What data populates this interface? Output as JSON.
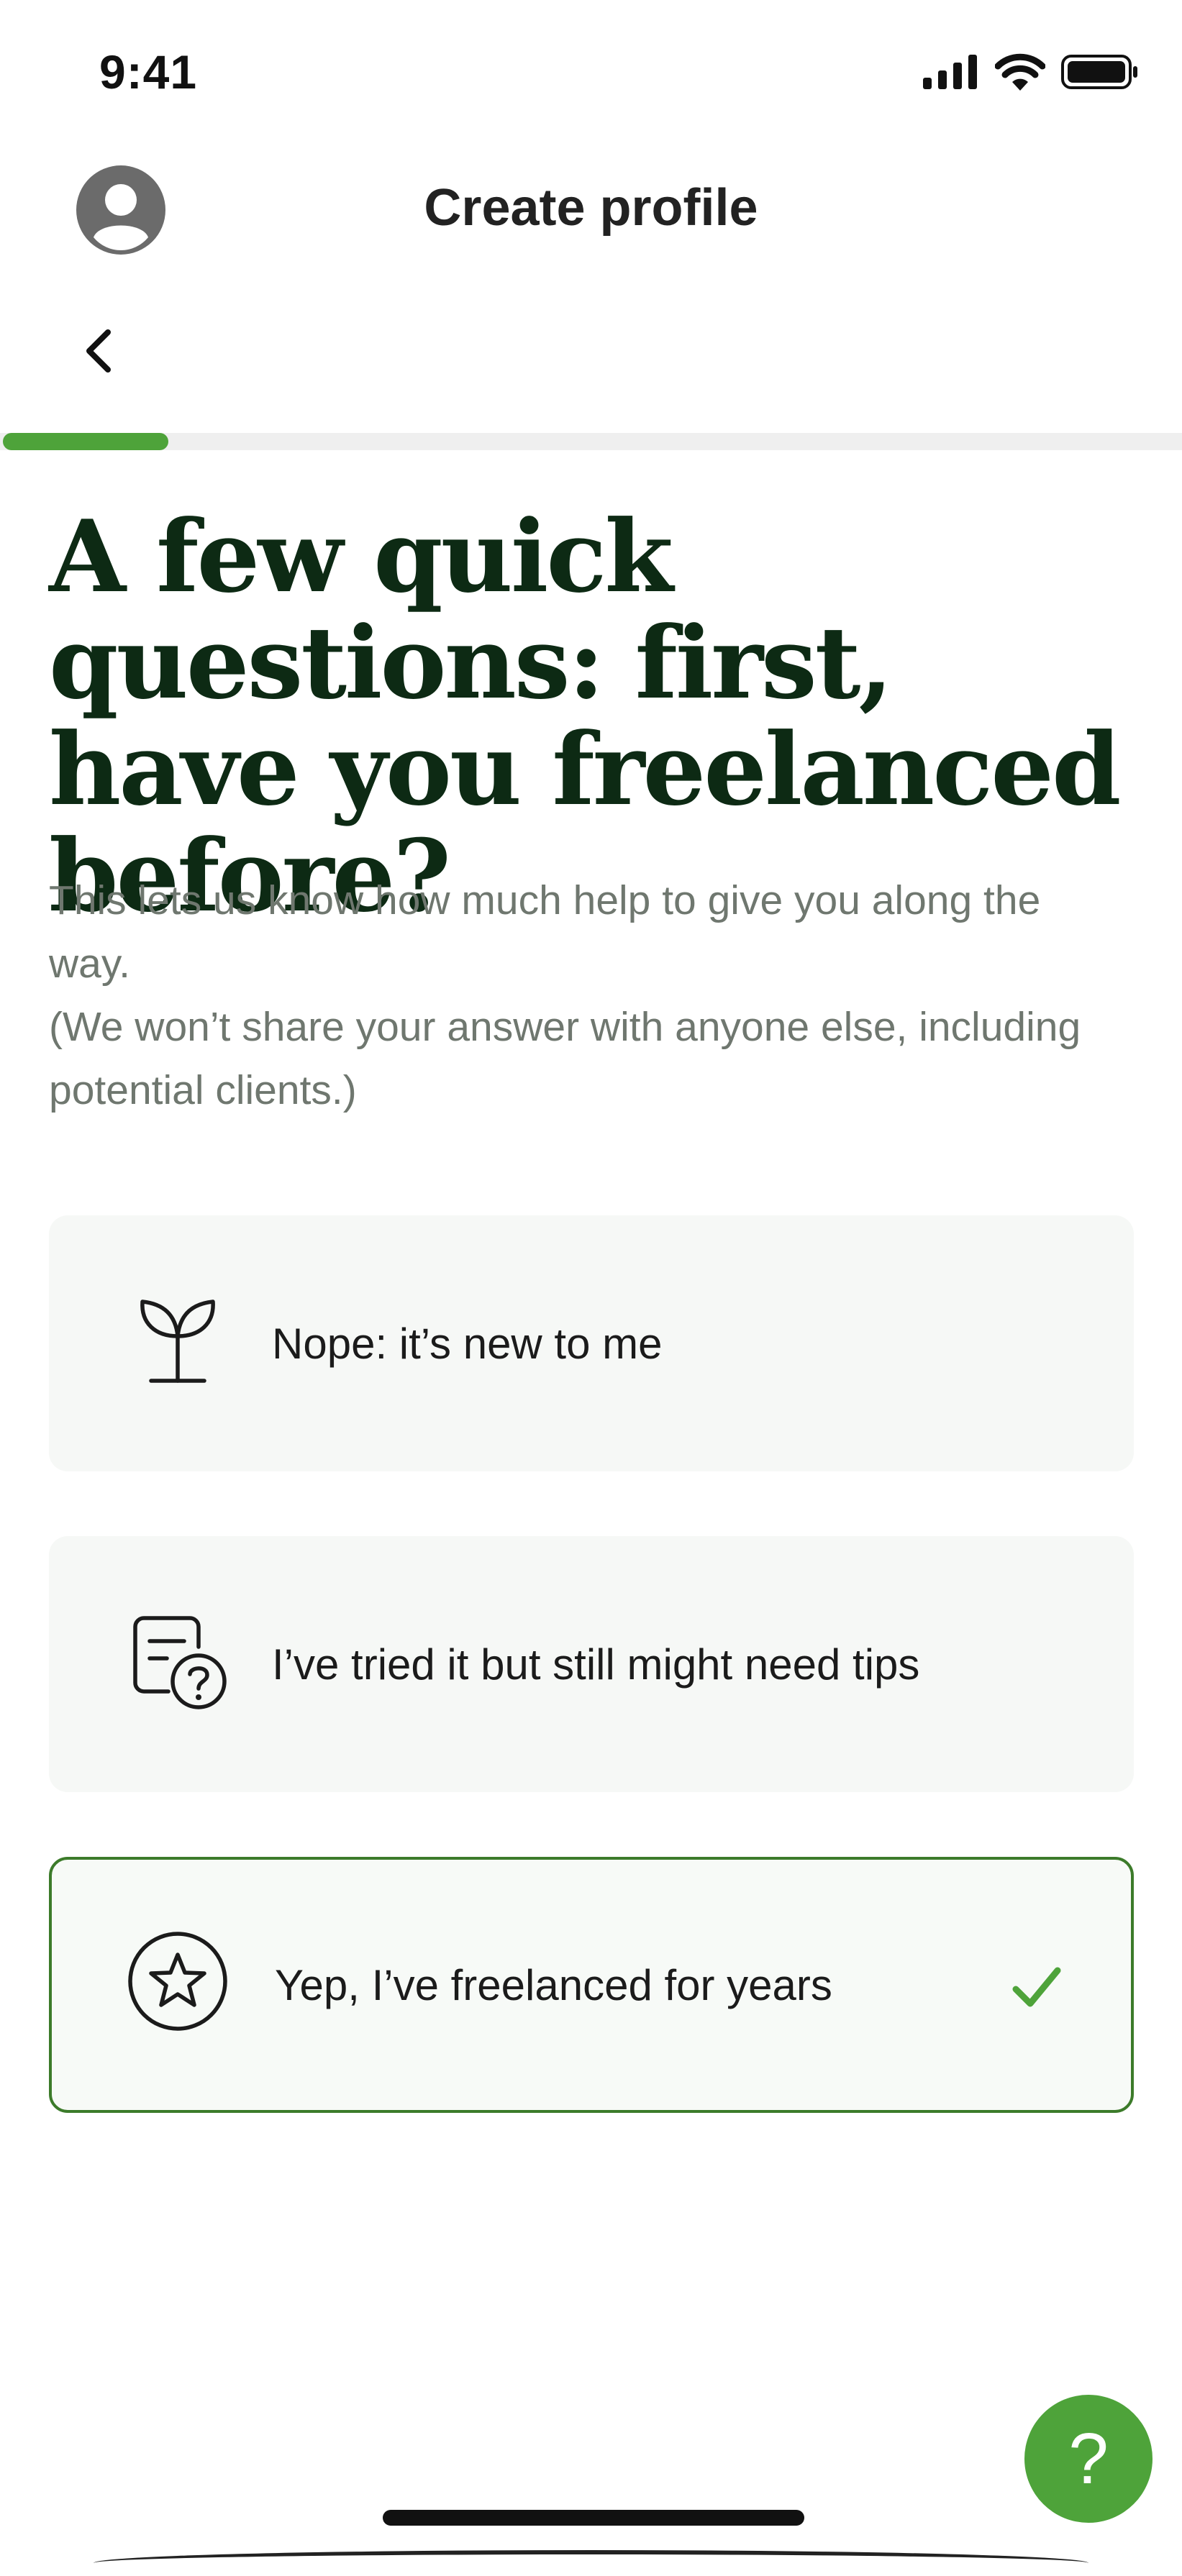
{
  "status_bar": {
    "time": "9:41",
    "icons": [
      "cellular-signal-icon",
      "wifi-icon",
      "battery-icon"
    ]
  },
  "header": {
    "title": "Create profile",
    "avatar_icon": "user-avatar-icon",
    "back_icon": "chevron-left-icon"
  },
  "progress": {
    "fraction": 0.14,
    "fill_color": "#4ea33a",
    "track_color": "#efefef"
  },
  "question": {
    "headline": "A few quick questions: first, have you freelanced before?",
    "subtext_line1": "This lets us know how much help to give you along the way.",
    "subtext_line2": "(We won’t share your answer with anyone else, including potential clients.)"
  },
  "options": [
    {
      "label": "Nope: it’s new to me",
      "icon": "sprout-icon",
      "selected": false
    },
    {
      "label": "I’ve tried it but still might need tips",
      "icon": "document-question-icon",
      "selected": false
    },
    {
      "label": "Yep, I’ve freelanced for years",
      "icon": "star-circle-icon",
      "selected": true
    }
  ],
  "help_button": {
    "label": "?",
    "color": "#4ea33a"
  },
  "colors": {
    "accent": "#4ea33a",
    "selected_border": "#3c7b2a",
    "headline": "#0d2a14"
  }
}
